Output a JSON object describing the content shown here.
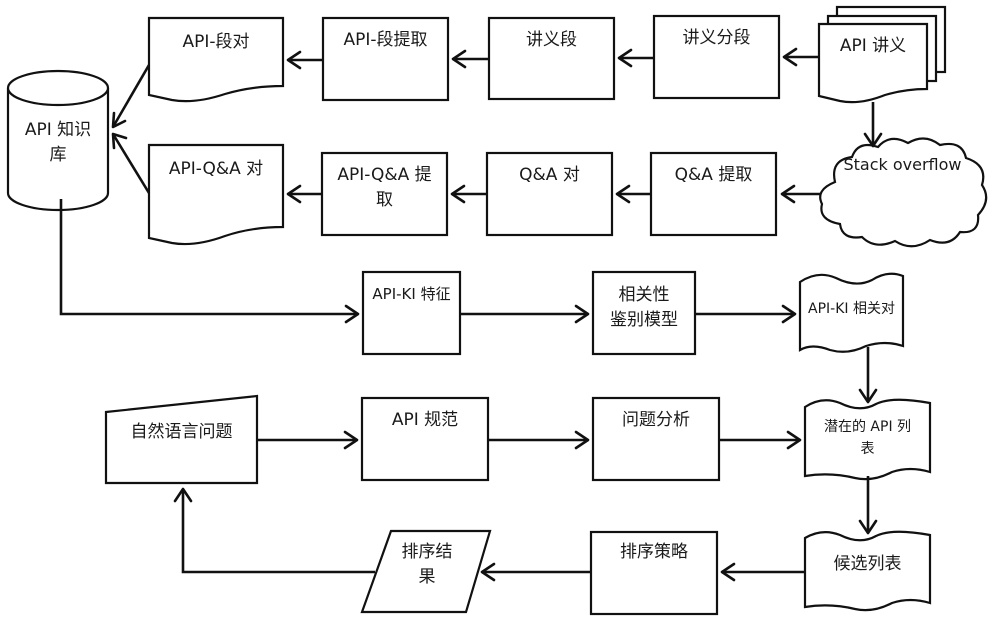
{
  "diagram": {
    "type": "flowchart",
    "stroke_color": "#111111",
    "background": "#ffffff",
    "nodes": {
      "knowledge_base": {
        "shape": "cylinder",
        "label": "API 知识\n库"
      },
      "api_segment_pair": {
        "shape": "document",
        "label": "API-段对"
      },
      "api_segment_extract": {
        "shape": "process",
        "label": "API-段提取"
      },
      "handout_segment": {
        "shape": "process",
        "label": "讲义段"
      },
      "handout_segmentation": {
        "shape": "process",
        "label": "讲义分段"
      },
      "api_handout": {
        "shape": "multi-document",
        "label": "API 讲义"
      },
      "api_qa_pair": {
        "shape": "document",
        "label": "API-Q&A 对"
      },
      "api_qa_extract": {
        "shape": "process",
        "label": "API-Q&A 提\n取"
      },
      "qa_pair": {
        "shape": "process",
        "label": "Q&A 对"
      },
      "qa_extract": {
        "shape": "process",
        "label": "Q&A 提取"
      },
      "stack_overflow": {
        "shape": "cloud",
        "label": "Stack overflow"
      },
      "api_ki_feature": {
        "shape": "process",
        "label": "API-KI 特征"
      },
      "relevance_model": {
        "shape": "process",
        "label": "相关性\n鉴别模型"
      },
      "api_ki_relevant_pair": {
        "shape": "punched-tape",
        "label": "API-KI 相关对"
      },
      "nl_question": {
        "shape": "manual-input",
        "label": "自然语言问题"
      },
      "api_spec": {
        "shape": "process",
        "label": "API 规范"
      },
      "question_analysis": {
        "shape": "process",
        "label": "问题分析"
      },
      "potential_api_list": {
        "shape": "punched-tape",
        "label": "潜在的 API 列\n表"
      },
      "candidate_list": {
        "shape": "punched-tape",
        "label": "候选列表"
      },
      "ranking_strategy": {
        "shape": "process",
        "label": "排序策略"
      },
      "ranking_result": {
        "shape": "data",
        "label": "排序结\n果"
      }
    },
    "edges": [
      {
        "from": "api_handout",
        "to": "handout_segmentation"
      },
      {
        "from": "handout_segmentation",
        "to": "handout_segment"
      },
      {
        "from": "handout_segment",
        "to": "api_segment_extract"
      },
      {
        "from": "api_segment_extract",
        "to": "api_segment_pair"
      },
      {
        "from": "api_segment_pair",
        "to": "knowledge_base"
      },
      {
        "from": "api_handout",
        "to": "stack_overflow"
      },
      {
        "from": "stack_overflow",
        "to": "qa_extract"
      },
      {
        "from": "qa_extract",
        "to": "qa_pair"
      },
      {
        "from": "qa_pair",
        "to": "api_qa_extract"
      },
      {
        "from": "api_qa_extract",
        "to": "api_qa_pair"
      },
      {
        "from": "api_qa_pair",
        "to": "knowledge_base"
      },
      {
        "from": "knowledge_base",
        "to": "api_ki_feature"
      },
      {
        "from": "api_ki_feature",
        "to": "relevance_model"
      },
      {
        "from": "relevance_model",
        "to": "api_ki_relevant_pair"
      },
      {
        "from": "api_ki_relevant_pair",
        "to": "potential_api_list"
      },
      {
        "from": "nl_question",
        "to": "api_spec"
      },
      {
        "from": "api_spec",
        "to": "question_analysis"
      },
      {
        "from": "question_analysis",
        "to": "potential_api_list"
      },
      {
        "from": "potential_api_list",
        "to": "candidate_list"
      },
      {
        "from": "candidate_list",
        "to": "ranking_strategy"
      },
      {
        "from": "ranking_strategy",
        "to": "ranking_result"
      },
      {
        "from": "ranking_result",
        "to": "nl_question"
      }
    ]
  }
}
